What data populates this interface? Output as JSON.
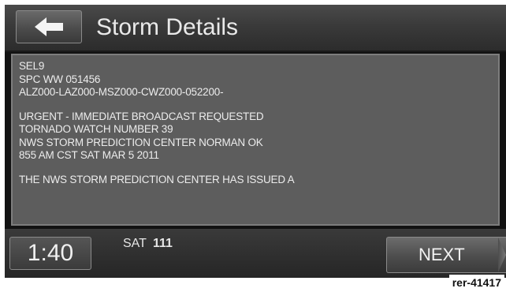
{
  "header": {
    "back_icon": "left-arrow-icon",
    "title": "Storm Details"
  },
  "message": {
    "lines": [
      "SEL9",
      "SPC WW 051456",
      "ALZ000-LAZ000-MSZ000-CWZ000-052200-",
      "",
      "URGENT - IMMEDIATE BROADCAST REQUESTED",
      "TORNADO WATCH NUMBER 39",
      "NWS STORM PREDICTION CENTER NORMAN OK",
      "855 AM CST SAT MAR 5 2011",
      "",
      "THE NWS STORM PREDICTION CENTER HAS ISSUED A"
    ]
  },
  "footer": {
    "clock": "1:40",
    "band": "SAT",
    "channel": "111",
    "next_label": "NEXT"
  },
  "reference": "rer-41417",
  "colors": {
    "screen_bg": "#121212",
    "panel_bg": "#5d5d5d",
    "text": "#ececec"
  }
}
